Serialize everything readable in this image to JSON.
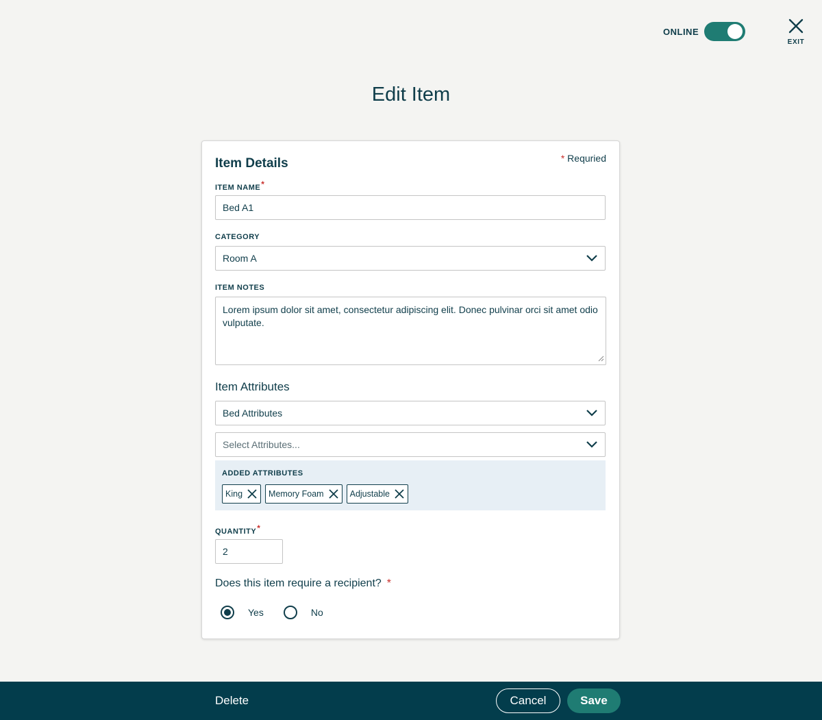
{
  "header": {
    "online_label": "ONLINE",
    "online_state": true,
    "exit_label": "EXIT",
    "page_title": "Edit Item"
  },
  "form": {
    "section_title": "Item Details",
    "required_star": "*",
    "required_note": "Requried",
    "item_name": {
      "label": "ITEM NAME",
      "value": "Bed A1"
    },
    "category": {
      "label": "CATEGORY",
      "value": "Room A"
    },
    "item_notes": {
      "label": "ITEM NOTES",
      "value": "Lorem ipsum dolor sit amet, consectetur adipiscing elit. Donec pulvinar orci sit amet odio vulputate."
    },
    "attributes": {
      "heading": "Item Attributes",
      "type_value": "Bed Attributes",
      "select_placeholder": "Select Attributes...",
      "added_label": "ADDED ATTRIBUTES",
      "chips": [
        "King",
        "Memory Foam",
        "Adjustable"
      ]
    },
    "quantity": {
      "label": "QUANTITY",
      "value": "2"
    },
    "recipient": {
      "question": "Does this item require a recipient?",
      "options": [
        "Yes",
        "No"
      ],
      "selected": "Yes"
    }
  },
  "footer": {
    "delete_label": "Delete",
    "cancel_label": "Cancel",
    "save_label": "Save"
  },
  "colors": {
    "primary_dark": "#033d4c",
    "accent_green": "#1f7c73",
    "required_red": "#c9302c",
    "attr_panel_bg": "#e7eff5"
  }
}
